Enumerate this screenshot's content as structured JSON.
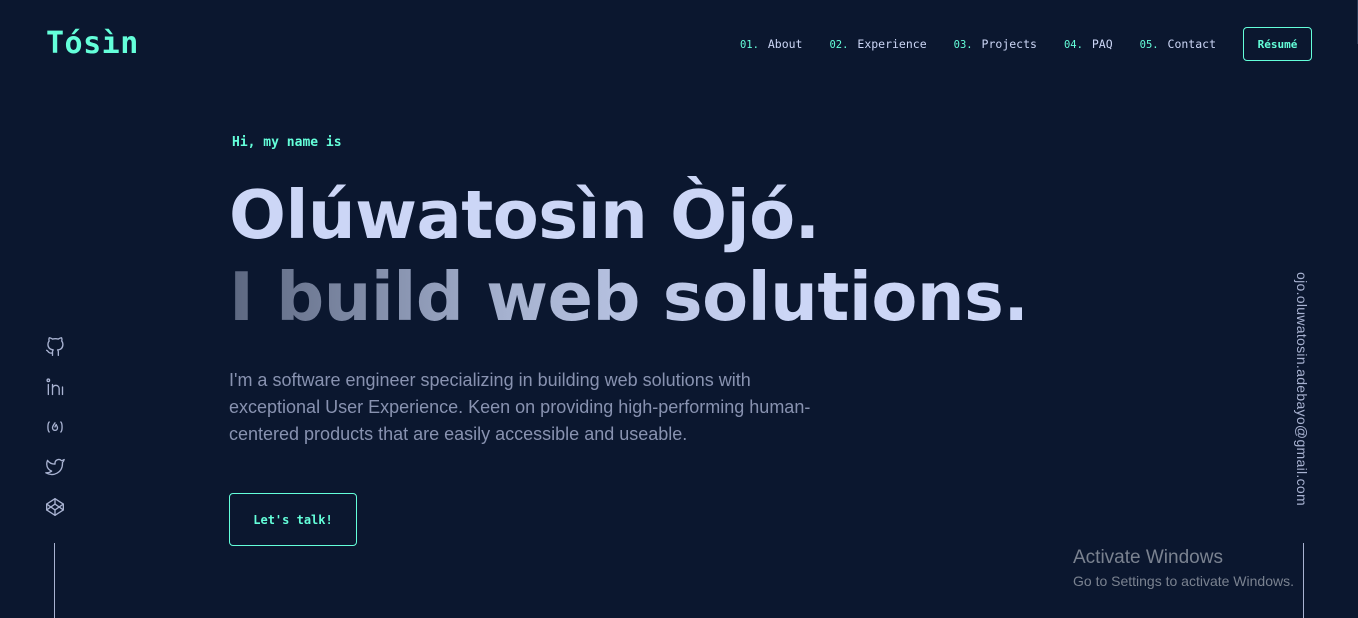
{
  "header": {
    "logo": "Tósìn",
    "nav": [
      {
        "num": "01.",
        "label": "About"
      },
      {
        "num": "02.",
        "label": "Experience"
      },
      {
        "num": "03.",
        "label": "Projects"
      },
      {
        "num": "04.",
        "label": "PAQ"
      },
      {
        "num": "05.",
        "label": "Contact"
      }
    ],
    "resume_label": "Résumé"
  },
  "hero": {
    "greeting": "Hi, my name is",
    "name": "Olúwatosìn Òjó.",
    "tagline": "I build web solutions.",
    "bio": "I'm a software engineer specializing in building web solutions with exceptional User Experience. Keen on providing high-performing human-centered products that are easily accessible and useable.",
    "cta_label": "Let's talk!"
  },
  "social": [
    {
      "icon": "github-icon"
    },
    {
      "icon": "linkedin-icon"
    },
    {
      "icon": "freecodecamp-icon"
    },
    {
      "icon": "twitter-icon"
    },
    {
      "icon": "codepen-icon"
    }
  ],
  "email": "ojo.oluwatosin.adebayo@gmail.com",
  "watermark": {
    "title": "Activate Windows",
    "subtitle": "Go to Settings to activate Windows."
  },
  "colors": {
    "background": "#0b172f",
    "accent": "#64ffda",
    "heading": "#ccd6f6",
    "body_text": "#8892b0"
  }
}
